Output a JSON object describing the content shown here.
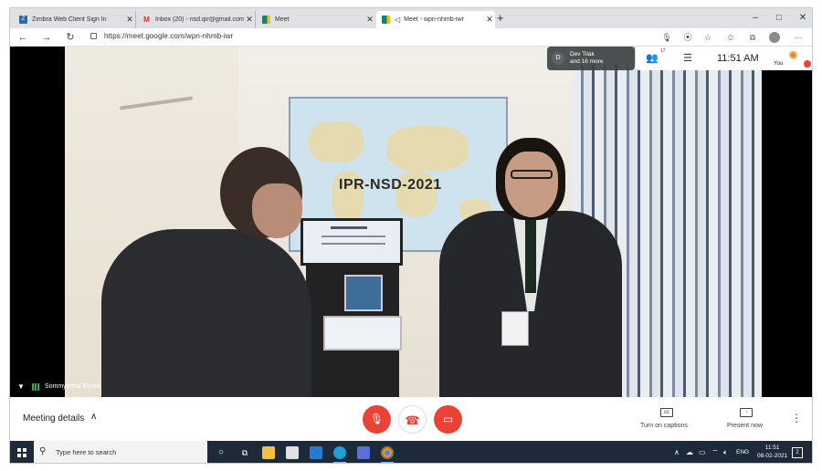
{
  "browser": {
    "tabs": [
      {
        "title": "Zimbra Web Client Sign In",
        "favicon_color": "#2b6cb0",
        "fav_letter": "Z"
      },
      {
        "title": "Inbox (20) - nsd.ipr@gmail.com",
        "favicon_color": "#d93025",
        "fav_letter": "M"
      },
      {
        "title": "Meet",
        "favicon_color": "#00897b",
        "fav_letter": ""
      },
      {
        "title": "Meet - wpn-nhmb-iwr",
        "favicon_color": "#00897b",
        "fav_letter": ""
      }
    ],
    "new_tab": "+",
    "window_controls": {
      "minimize": "–",
      "maximize": "□",
      "close": "✕"
    },
    "nav": {
      "back": "←",
      "forward": "→",
      "reload": "↻"
    },
    "url": "https://meet.google.com/wpn-nhmb-iwr",
    "toolbar_icons": [
      "mic-icon",
      "camera-icon",
      "star-icon",
      "favorites-icon",
      "collections-icon",
      "profile-icon",
      "more-icon"
    ],
    "more_label": "···"
  },
  "meet": {
    "banner": "IPR-NSD-2021",
    "participant_chip": {
      "initial": "D",
      "line1": "Dev Tilak",
      "line2": "and 16 more"
    },
    "participant_count": "17",
    "clock": "11:51 AM",
    "self_label": "You",
    "speaker_name": "Sommyartha Biyani",
    "meeting_details": "Meeting details",
    "captions_label": "Turn on captions",
    "present_label": "Present now",
    "accent_red": "#ea4335"
  },
  "taskbar": {
    "search_placeholder": "Type here to search",
    "lang": "ENG",
    "time": "11:51",
    "date": "08-02-2021",
    "notification_count": "2"
  }
}
